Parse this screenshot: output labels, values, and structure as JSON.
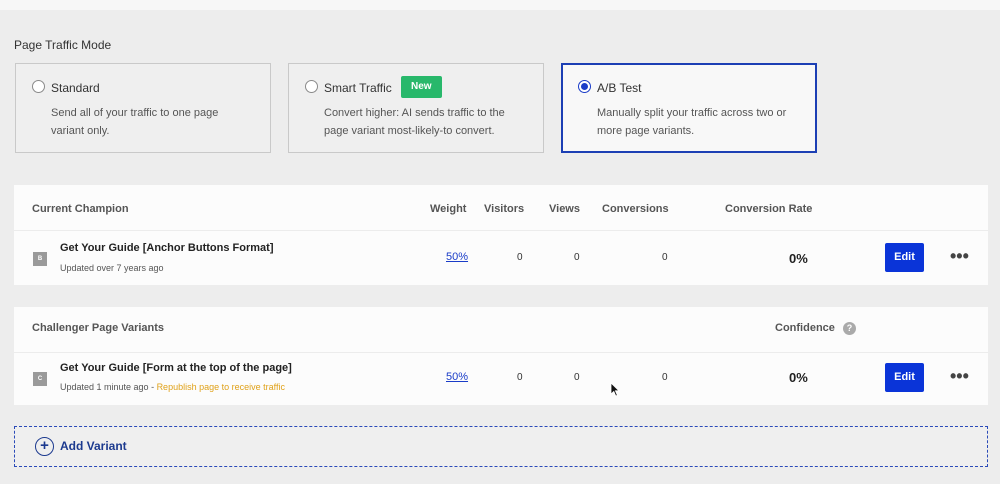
{
  "traffic_mode": {
    "label": "Page Traffic Mode",
    "options": [
      {
        "title": "Standard",
        "desc": "Send all of your traffic to one page variant only.",
        "selected": false
      },
      {
        "title": "Smart Traffic",
        "badge": "New",
        "desc": "Convert higher: AI sends traffic to the page variant most-likely-to convert.",
        "selected": false
      },
      {
        "title": "A/B Test",
        "desc": "Manually split your traffic across two or more page variants.",
        "selected": true
      }
    ]
  },
  "champion": {
    "header": "Current Champion",
    "columns": {
      "weight": "Weight",
      "visitors": "Visitors",
      "views": "Views",
      "conversions": "Conversions",
      "conversion_rate": "Conversion Rate"
    },
    "variant": {
      "letter": "B",
      "name": "Get Your Guide [Anchor Buttons Format]",
      "updated": "Updated over 7 years ago",
      "weight": "50%",
      "visitors": "0",
      "views": "0",
      "conversions": "0",
      "rate": "0%",
      "edit_label": "Edit",
      "more": "•••"
    }
  },
  "challengers": {
    "header": "Challenger Page Variants",
    "confidence": "Confidence",
    "help": "?",
    "variant": {
      "letter": "C",
      "name": "Get Your Guide [Form at the top of the page]",
      "updated": "Updated 1 minute ago - ",
      "warning": "Republish page to receive traffic",
      "weight": "50%",
      "visitors": "0",
      "views": "0",
      "conversions": "0",
      "rate": "0%",
      "edit_label": "Edit",
      "more": "•••"
    }
  },
  "add_variant": {
    "icon": "+",
    "label": "Add Variant"
  },
  "colors": {
    "primary": "#0a34d8",
    "selected_border": "#1c3fb4",
    "badge": "#28b86b",
    "warning": "#e0a21a"
  }
}
